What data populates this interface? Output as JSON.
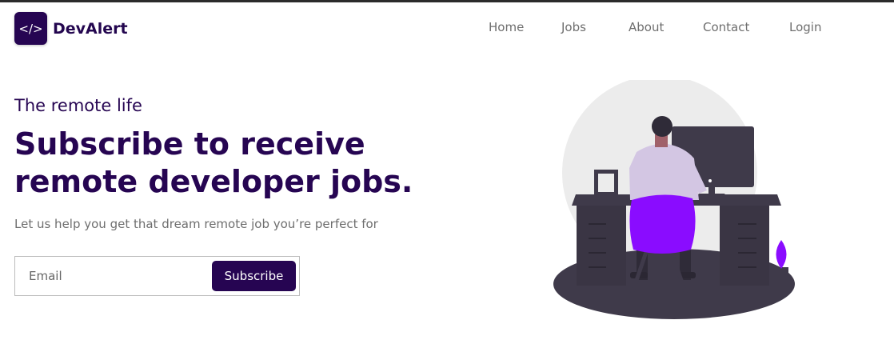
{
  "brand": {
    "logo_glyph": "</>",
    "name": "DevAlert"
  },
  "nav": {
    "items": [
      "Home",
      "Jobs",
      "About",
      "Contact",
      "Login"
    ]
  },
  "hero": {
    "eyebrow": "The remote life",
    "headline_line1": "Subscribe to receive",
    "headline_line2": "remote developer jobs.",
    "subtext": "Let us help you get that dream remote job you’re perfect for"
  },
  "form": {
    "email_placeholder": "Email",
    "email_value": "",
    "subscribe_label": "Subscribe"
  },
  "colors": {
    "brand": "#260552",
    "accent": "#8a0cff",
    "text_muted": "#6e6e6e",
    "illustration_dark": "#3f3a4a",
    "shirt": "#d3c6e3",
    "background_circle": "#ececec"
  },
  "icons": {
    "logo": "code-brackets-icon",
    "illustration": "remote-developer-at-desk-illustration"
  }
}
